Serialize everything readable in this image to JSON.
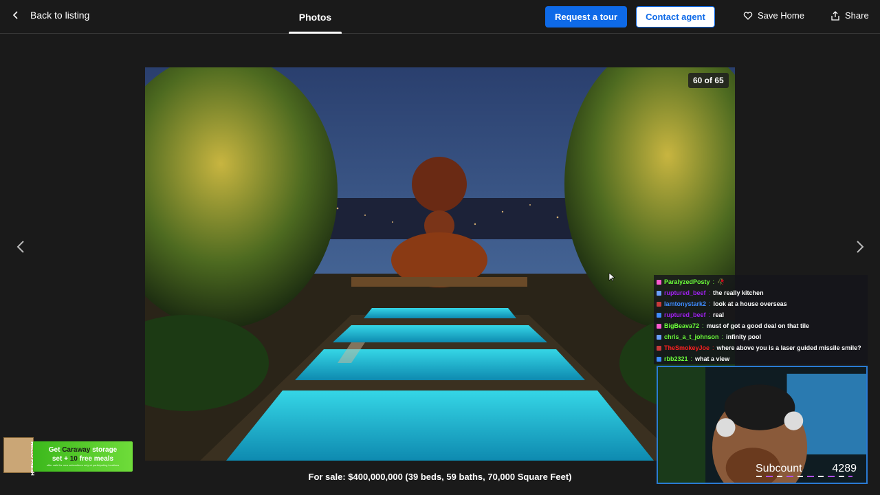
{
  "header": {
    "back_label": "Back to listing",
    "tab_label": "Photos",
    "request_tour_label": "Request a tour",
    "contact_agent_label": "Contact agent",
    "save_home_label": "Save Home",
    "share_label": "Share"
  },
  "gallery": {
    "counter": "60 of 65",
    "current_index": 60,
    "total": 65,
    "caption": "For sale: $400,000,000 (39 beds, 59 baths, 70,000 Square Feet)"
  },
  "colors": {
    "accent": "#0e6ae8",
    "background": "#1a1a1a"
  },
  "stream": {
    "chat": [
      {
        "user": "ParalyzedPosty",
        "message": "🥀",
        "color": "#6cff3a"
      },
      {
        "user": "ruptured_beef",
        "message": "the really kitchen",
        "color": "#a020f0"
      },
      {
        "user": "Iamtonystark2",
        "message": "look at a house overseas",
        "color": "#3f8cff"
      },
      {
        "user": "ruptured_beef",
        "message": "real",
        "color": "#a020f0"
      },
      {
        "user": "BigBeava72",
        "message": "must of got a good deal on that tile",
        "color": "#6cff3a"
      },
      {
        "user": "chris_a_t_johnson",
        "message": "infinity pool",
        "color": "#6cff3a"
      },
      {
        "user": "TheSmokeyJoe",
        "message": "where above you is a laser guided missile smile?",
        "color": "#ff2020"
      },
      {
        "user": "rbb2321",
        "message": "what a view",
        "color": "#6cff3a"
      }
    ],
    "subcount_label": "Subcount",
    "subcount_value": "4289"
  },
  "ad": {
    "line1_pre": "Get ",
    "line1_brand": "Caraway",
    "line1_post": " storage",
    "line2_pre": "set + ",
    "line2_num": "10",
    "line2_post": " free meals",
    "box_text": "HELLO FRESH",
    "fine_print": "offer valid for new subscribers only at participating locations"
  }
}
